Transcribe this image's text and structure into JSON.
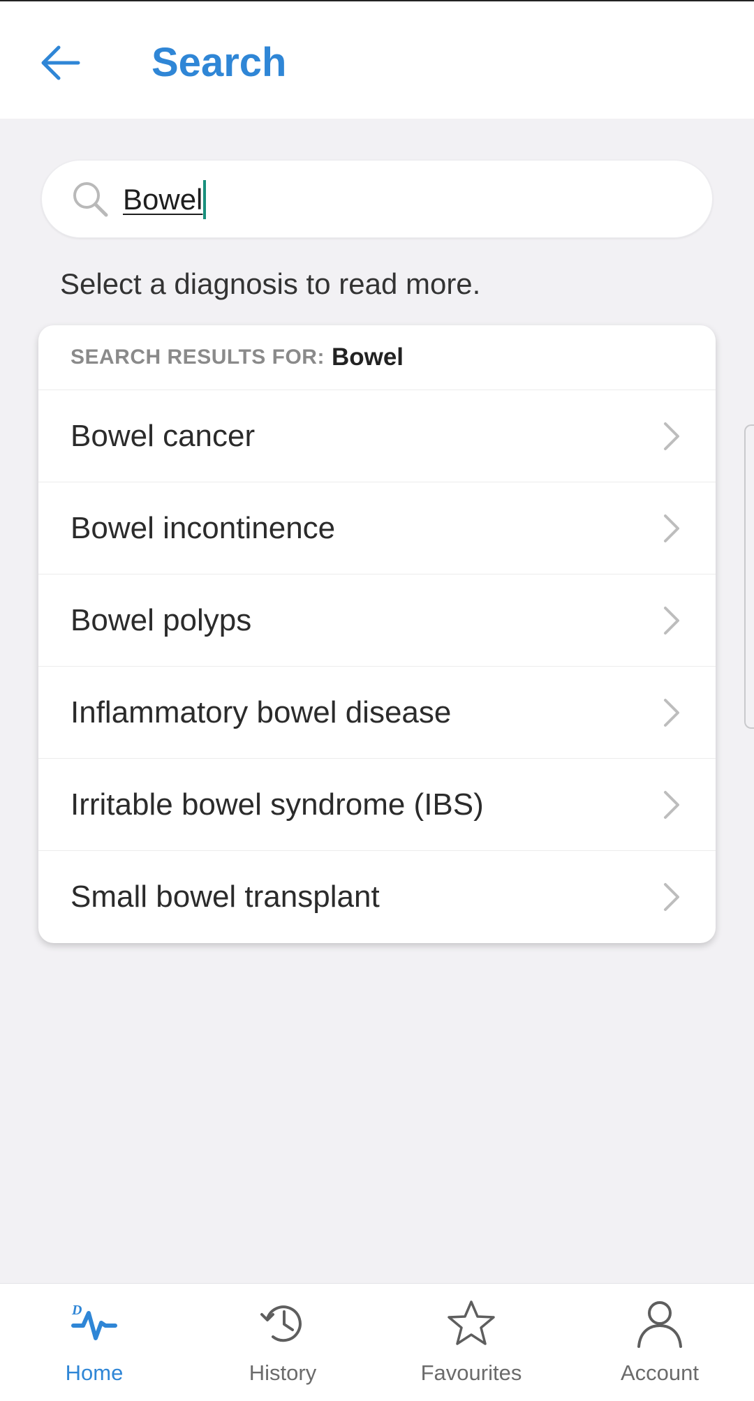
{
  "header": {
    "title": "Search",
    "back_icon": "arrow-left-icon"
  },
  "search": {
    "value": "Bowel",
    "icon": "search-icon"
  },
  "hint": "Select a diagnosis to read more.",
  "results": {
    "label": "SEARCH RESULTS FOR:",
    "term": "Bowel",
    "items": [
      {
        "label": "Bowel cancer"
      },
      {
        "label": "Bowel incontinence"
      },
      {
        "label": "Bowel polyps"
      },
      {
        "label": "Inflammatory bowel disease"
      },
      {
        "label": "Irritable bowel syndrome (IBS)"
      },
      {
        "label": "Small bowel transplant"
      }
    ]
  },
  "nav": {
    "items": [
      {
        "label": "Home",
        "icon": "home-pulse-icon",
        "active": true
      },
      {
        "label": "History",
        "icon": "history-clock-icon",
        "active": false
      },
      {
        "label": "Favourites",
        "icon": "star-icon",
        "active": false
      },
      {
        "label": "Account",
        "icon": "person-icon",
        "active": false
      }
    ]
  },
  "colors": {
    "accent": "#2f86d6",
    "background": "#f2f1f4",
    "caret": "#19907d"
  }
}
